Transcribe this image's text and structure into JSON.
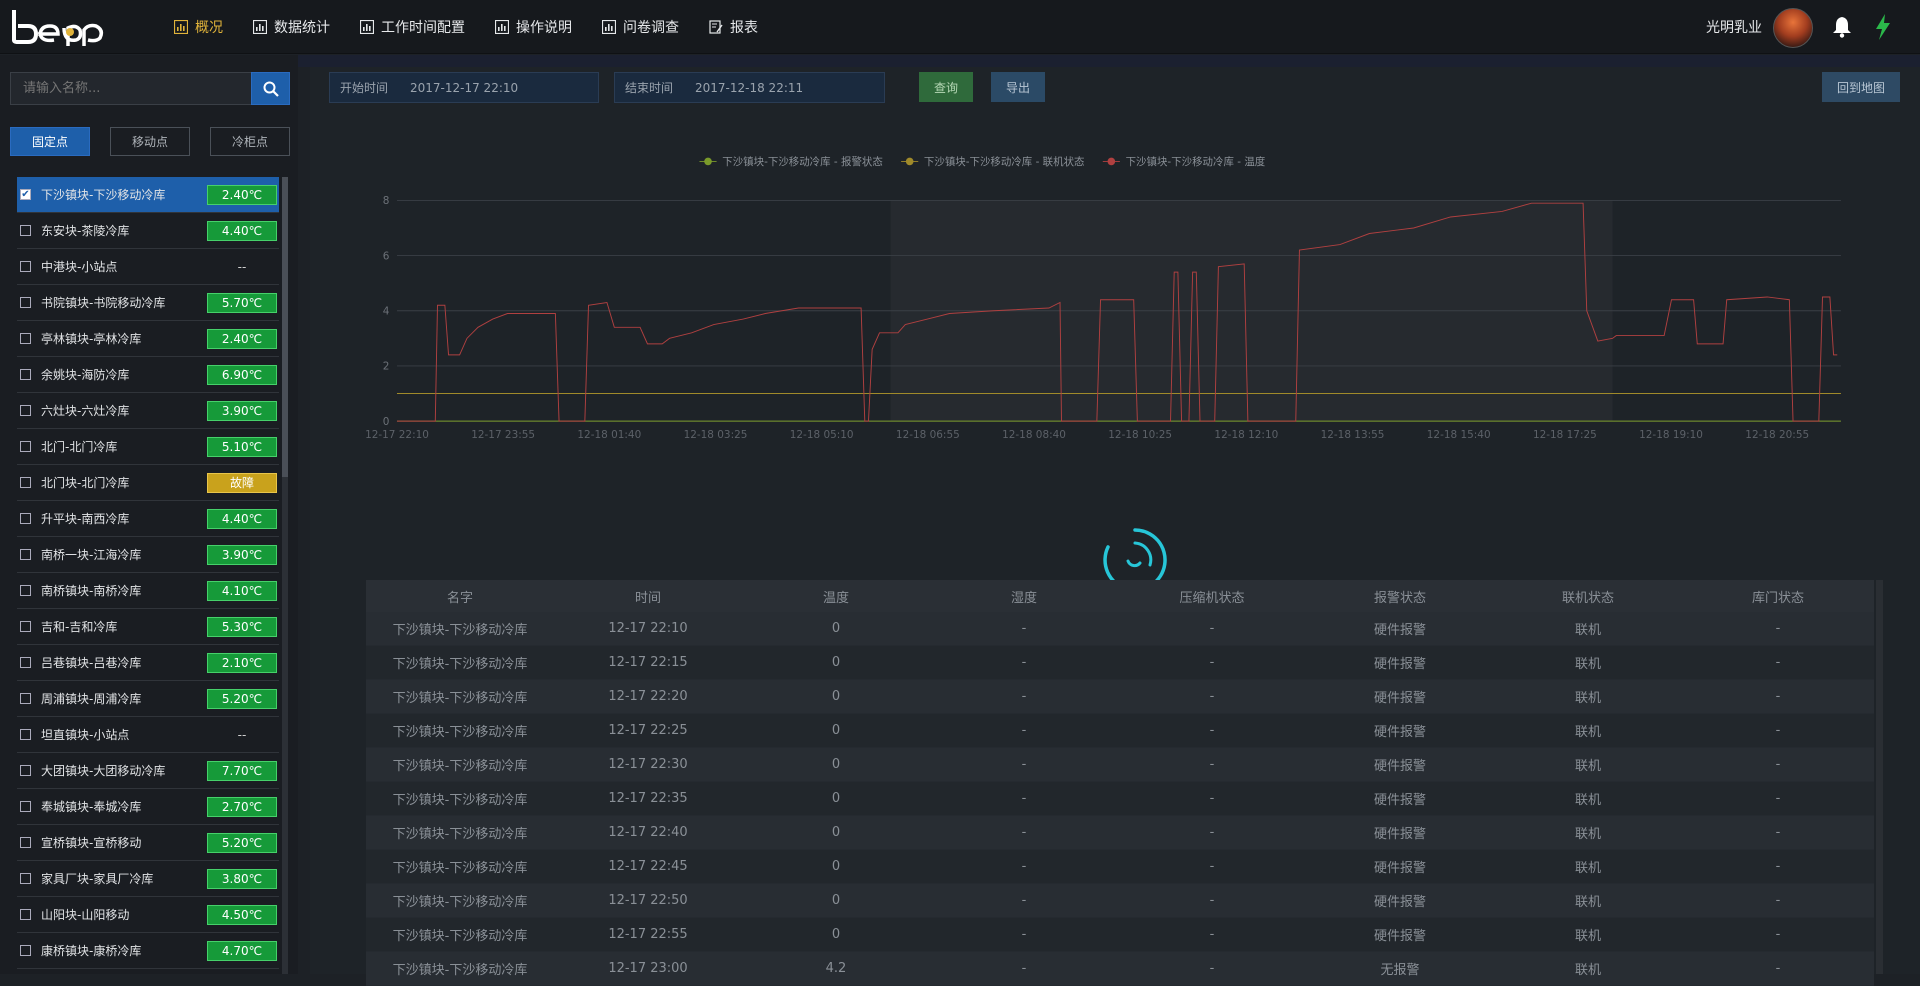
{
  "header": {
    "logo_text": "beap",
    "nav": [
      {
        "label": "概况",
        "icon": "bar-chart-icon",
        "active": true
      },
      {
        "label": "数据统计",
        "icon": "bar-chart-icon",
        "active": false
      },
      {
        "label": "工作时间配置",
        "icon": "bar-chart-icon",
        "active": false
      },
      {
        "label": "操作说明",
        "icon": "bar-chart-icon",
        "active": false
      },
      {
        "label": "问卷调查",
        "icon": "bar-chart-icon",
        "active": false
      },
      {
        "label": "报表",
        "icon": "edit-doc-icon",
        "active": false
      }
    ],
    "user_name": "光明乳业"
  },
  "sidebar": {
    "search_placeholder": "请输入名称...",
    "tabs": [
      "固定点",
      "移动点",
      "冷柜点"
    ],
    "items": [
      {
        "name": "下沙镇块-下沙移动冷库",
        "value": "2.40℃",
        "status": "ok",
        "checked": true
      },
      {
        "name": "东安块-茶陵冷库",
        "value": "4.40℃",
        "status": "ok",
        "checked": false
      },
      {
        "name": "中港块-小站点",
        "value": "--",
        "status": "none",
        "checked": false
      },
      {
        "name": "书院镇块-书院移动冷库",
        "value": "5.70℃",
        "status": "ok",
        "checked": false
      },
      {
        "name": "亭林镇块-亭林冷库",
        "value": "2.40℃",
        "status": "ok",
        "checked": false
      },
      {
        "name": "余姚块-海防冷库",
        "value": "6.90℃",
        "status": "ok",
        "checked": false
      },
      {
        "name": "六灶块-六灶冷库",
        "value": "3.90℃",
        "status": "ok",
        "checked": false
      },
      {
        "name": "北门-北门冷库",
        "value": "5.10℃",
        "status": "ok",
        "checked": false
      },
      {
        "name": "北门块-北门冷库",
        "value": "故障",
        "status": "warn",
        "checked": false
      },
      {
        "name": "升平块-南西冷库",
        "value": "4.40℃",
        "status": "ok",
        "checked": false
      },
      {
        "name": "南桥一块-江海冷库",
        "value": "3.90℃",
        "status": "ok",
        "checked": false
      },
      {
        "name": "南桥镇块-南桥冷库",
        "value": "4.10℃",
        "status": "ok",
        "checked": false
      },
      {
        "name": "吉和-吉和冷库",
        "value": "5.30℃",
        "status": "ok",
        "checked": false
      },
      {
        "name": "吕巷镇块-吕巷冷库",
        "value": "2.10℃",
        "status": "ok",
        "checked": false
      },
      {
        "name": "周浦镇块-周浦冷库",
        "value": "5.20℃",
        "status": "ok",
        "checked": false
      },
      {
        "name": "坦直镇块-小站点",
        "value": "--",
        "status": "none",
        "checked": false
      },
      {
        "name": "大团镇块-大团移动冷库",
        "value": "7.70℃",
        "status": "ok",
        "checked": false
      },
      {
        "name": "奉城镇块-奉城冷库",
        "value": "2.70℃",
        "status": "ok",
        "checked": false
      },
      {
        "name": "宣桥镇块-宣桥移动",
        "value": "5.20℃",
        "status": "ok",
        "checked": false
      },
      {
        "name": "家具厂块-家具厂冷库",
        "value": "3.80℃",
        "status": "ok",
        "checked": false
      },
      {
        "name": "山阳块-山阳移动",
        "value": "4.50℃",
        "status": "ok",
        "checked": false
      },
      {
        "name": "康桥镇块-康桥冷库",
        "value": "4.70℃",
        "status": "ok",
        "checked": false
      }
    ]
  },
  "filters": {
    "start_label": "开始时间",
    "start_value": "2017-12-17 22:10",
    "end_label": "结束时间",
    "end_value": "2017-12-18 22:11",
    "query_button": "查询",
    "export_button": "导出",
    "back_button": "回到地图"
  },
  "chart_data": {
    "type": "line",
    "legend": [
      "下沙镇块-下沙移动冷库 - 报警状态",
      "下沙镇块-下沙移动冷库 - 联机状态",
      "下沙镇块-下沙移动冷库 - 温度"
    ],
    "legend_colors": [
      "#7a9a2a",
      "#a08a2a",
      "#b04040"
    ],
    "x_ticks": [
      "12-17 22:10",
      "12-17 23:55",
      "12-18 01:40",
      "12-18 03:25",
      "12-18 05:10",
      "12-18 06:55",
      "12-18 08:40",
      "12-18 10:25",
      "12-18 12:10",
      "12-18 13:55",
      "12-18 15:40",
      "12-18 17:25",
      "12-18 19:10",
      "12-18 20:55"
    ],
    "y_ticks": [
      0,
      2,
      4,
      6,
      8
    ],
    "ylim": [
      0,
      8
    ],
    "legend_position": "top-center",
    "grid": true,
    "temperature": [
      [
        0,
        0
      ],
      [
        0.52,
        0
      ],
      [
        0.55,
        4.2
      ],
      [
        0.65,
        4.2
      ],
      [
        0.7,
        2.4
      ],
      [
        0.85,
        2.4
      ],
      [
        0.95,
        3.0
      ],
      [
        1.1,
        3.4
      ],
      [
        1.3,
        3.7
      ],
      [
        1.5,
        3.9
      ],
      [
        2.15,
        3.9
      ],
      [
        2.2,
        0
      ],
      [
        2.55,
        0
      ],
      [
        2.6,
        4.2
      ],
      [
        2.85,
        4.3
      ],
      [
        2.95,
        3.4
      ],
      [
        3.3,
        3.4
      ],
      [
        3.4,
        2.8
      ],
      [
        3.6,
        2.8
      ],
      [
        3.7,
        3.0
      ],
      [
        4.0,
        3.2
      ],
      [
        4.3,
        3.5
      ],
      [
        4.7,
        3.7
      ],
      [
        5.0,
        3.9
      ],
      [
        5.45,
        4.1
      ],
      [
        6.3,
        4.1
      ],
      [
        6.35,
        0
      ],
      [
        6.4,
        0
      ],
      [
        6.45,
        2.6
      ],
      [
        6.55,
        3.2
      ],
      [
        6.8,
        3.2
      ],
      [
        6.9,
        3.5
      ],
      [
        7.2,
        3.7
      ],
      [
        7.5,
        3.9
      ],
      [
        8.1,
        4.0
      ],
      [
        8.85,
        4.1
      ],
      [
        9.0,
        4.3
      ],
      [
        9.02,
        0
      ],
      [
        9.5,
        0
      ],
      [
        9.55,
        4.4
      ],
      [
        10.0,
        4.4
      ],
      [
        10.05,
        0
      ],
      [
        10.5,
        0
      ],
      [
        10.55,
        5.4
      ],
      [
        10.6,
        5.4
      ],
      [
        10.65,
        0
      ],
      [
        10.75,
        0
      ],
      [
        10.8,
        5.4
      ],
      [
        10.85,
        5.4
      ],
      [
        10.9,
        0
      ],
      [
        11.1,
        0
      ],
      [
        11.15,
        5.6
      ],
      [
        11.5,
        5.7
      ],
      [
        11.55,
        0
      ],
      [
        12.2,
        0
      ],
      [
        12.25,
        6.2
      ],
      [
        12.8,
        6.4
      ],
      [
        13.2,
        6.8
      ],
      [
        13.8,
        7.0
      ],
      [
        14.3,
        7.4
      ],
      [
        15.0,
        7.6
      ],
      [
        15.4,
        7.9
      ],
      [
        16.1,
        7.9
      ],
      [
        16.15,
        4.0
      ],
      [
        16.3,
        2.9
      ],
      [
        16.5,
        3.0
      ],
      [
        16.55,
        3.1
      ],
      [
        17.2,
        3.1
      ],
      [
        17.3,
        4.4
      ],
      [
        17.6,
        4.4
      ],
      [
        17.65,
        2.8
      ],
      [
        18.0,
        2.8
      ],
      [
        18.05,
        4.4
      ],
      [
        18.6,
        4.5
      ],
      [
        18.9,
        4.4
      ],
      [
        18.95,
        0
      ],
      [
        19.3,
        0
      ],
      [
        19.35,
        4.5
      ],
      [
        19.45,
        4.5
      ],
      [
        19.5,
        2.4
      ],
      [
        19.55,
        2.4
      ]
    ],
    "online": 1,
    "alarm": 0
  },
  "table": {
    "headers": [
      "名字",
      "时间",
      "温度",
      "湿度",
      "压缩机状态",
      "报警状态",
      "联机状态",
      "库门状态"
    ],
    "rows": [
      [
        "下沙镇块-下沙移动冷库",
        "12-17 22:10",
        "0",
        "-",
        "-",
        "硬件报警",
        "联机",
        "-"
      ],
      [
        "下沙镇块-下沙移动冷库",
        "12-17 22:15",
        "0",
        "-",
        "-",
        "硬件报警",
        "联机",
        "-"
      ],
      [
        "下沙镇块-下沙移动冷库",
        "12-17 22:20",
        "0",
        "-",
        "-",
        "硬件报警",
        "联机",
        "-"
      ],
      [
        "下沙镇块-下沙移动冷库",
        "12-17 22:25",
        "0",
        "-",
        "-",
        "硬件报警",
        "联机",
        "-"
      ],
      [
        "下沙镇块-下沙移动冷库",
        "12-17 22:30",
        "0",
        "-",
        "-",
        "硬件报警",
        "联机",
        "-"
      ],
      [
        "下沙镇块-下沙移动冷库",
        "12-17 22:35",
        "0",
        "-",
        "-",
        "硬件报警",
        "联机",
        "-"
      ],
      [
        "下沙镇块-下沙移动冷库",
        "12-17 22:40",
        "0",
        "-",
        "-",
        "硬件报警",
        "联机",
        "-"
      ],
      [
        "下沙镇块-下沙移动冷库",
        "12-17 22:45",
        "0",
        "-",
        "-",
        "硬件报警",
        "联机",
        "-"
      ],
      [
        "下沙镇块-下沙移动冷库",
        "12-17 22:50",
        "0",
        "-",
        "-",
        "硬件报警",
        "联机",
        "-"
      ],
      [
        "下沙镇块-下沙移动冷库",
        "12-17 22:55",
        "0",
        "-",
        "-",
        "硬件报警",
        "联机",
        "-"
      ],
      [
        "下沙镇块-下沙移动冷库",
        "12-17 23:00",
        "4.2",
        "-",
        "-",
        "无报警",
        "联机",
        "-"
      ]
    ]
  }
}
